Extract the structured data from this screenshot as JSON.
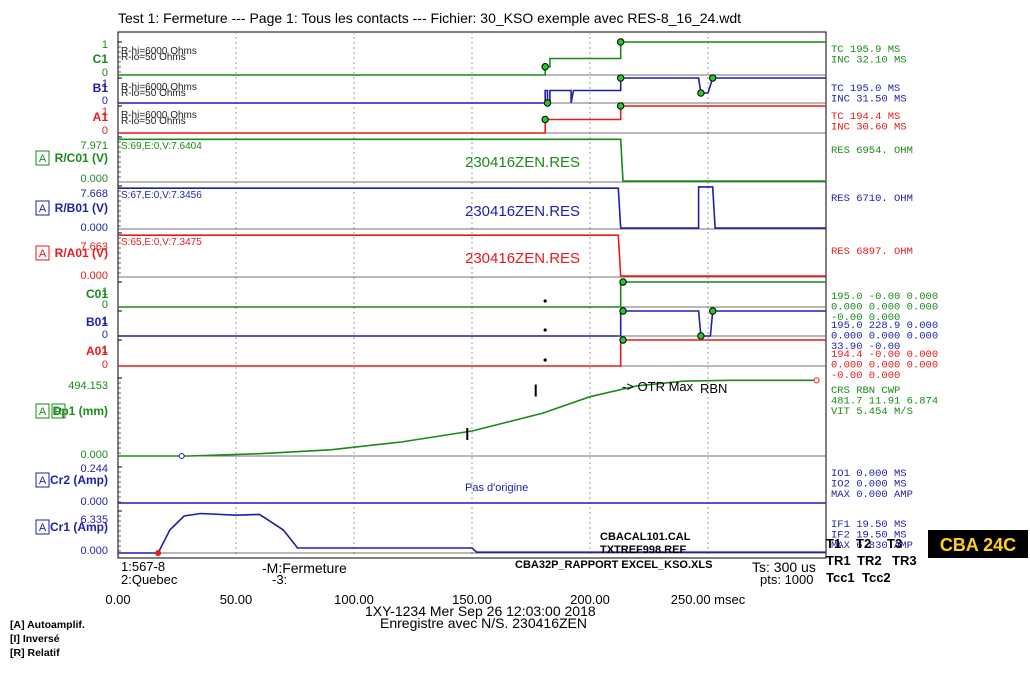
{
  "header": {
    "title": "Test 1: Fermeture --- Page 1: Tous les contacts  --- Fichier: 30_KSO exemple avec  RES-8_16_24.wdt"
  },
  "colors": {
    "green": "#1a8a1a",
    "lightgreen": "#33dd33",
    "blue": "#1f1fa8",
    "red": "#e81a1a",
    "black": "#000000",
    "badge_bg": "#000000",
    "badge_fg": "#ffd21a"
  },
  "chart_data": {
    "type": "line",
    "x_axis": {
      "min": 0,
      "max": 300,
      "unit": "msec",
      "ticks": [
        0,
        50,
        100,
        150,
        200,
        250
      ],
      "tick_labels": [
        "0.00",
        "50.00",
        "100.00",
        "150.00",
        "200.00",
        "250.00 msec"
      ]
    },
    "channels": [
      {
        "key": "c1",
        "label": "C1",
        "color": "green",
        "top": "1",
        "bottom": "0",
        "texts": [
          "R-hi=6000 Ohms",
          "R-lo=50 Ohms"
        ],
        "right_lines": [
          "TC       195.9  MS",
          "INC      32.10  MS"
        ],
        "points": [
          [
            0,
            0
          ],
          [
            181,
            0
          ],
          [
            181,
            0.25
          ],
          [
            183,
            0.25
          ],
          [
            183,
            0.5
          ],
          [
            213,
            0.5
          ],
          [
            213,
            1
          ],
          [
            300,
            1
          ]
        ],
        "markers": [
          181,
          213
        ]
      },
      {
        "key": "b1",
        "label": "B1",
        "color": "blue",
        "top": "1",
        "bottom": "0",
        "texts": [
          "R-hi=6000 Ohms",
          "R-lo=50 Ohms"
        ],
        "right_lines": [
          "TC       195.0  MS",
          "INC      31.50  MS"
        ],
        "points": [
          [
            0,
            0
          ],
          [
            181,
            0
          ],
          [
            181,
            0.5
          ],
          [
            182,
            0.5
          ],
          [
            182,
            0
          ],
          [
            183,
            0
          ],
          [
            183,
            0.5
          ],
          [
            192,
            0.5
          ],
          [
            192,
            0
          ],
          [
            193,
            0.5
          ],
          [
            213,
            0.5
          ],
          [
            213,
            1
          ],
          [
            246,
            1
          ],
          [
            247,
            0.4
          ],
          [
            250,
            0.4
          ],
          [
            252,
            1
          ],
          [
            300,
            1
          ]
        ],
        "markers": [
          182,
          213,
          247,
          252
        ]
      },
      {
        "key": "a1",
        "label": "A1",
        "color": "red",
        "top": "1",
        "bottom": "0",
        "texts": [
          "R-hi=6000 Ohms",
          "R-lo=50 Ohms"
        ],
        "right_lines": [
          "TC       194.4  MS",
          "INC      30.60  MS"
        ],
        "points": [
          [
            0,
            0
          ],
          [
            181,
            0
          ],
          [
            181,
            0.5
          ],
          [
            213,
            0.5
          ],
          [
            213,
            1
          ],
          [
            300,
            1
          ]
        ],
        "markers": [
          181,
          213
        ]
      },
      {
        "key": "rc01",
        "label": "R/C01 (V)",
        "flags": [
          "A"
        ],
        "color": "green",
        "top": "7.971",
        "bottom": "0.000",
        "texts": [
          "S:69,E:0,V:7.6404"
        ],
        "res": "230416ZEN.RES",
        "right_lines": [
          "RES      6954.  OHM"
        ],
        "points": [
          [
            0,
            0.95
          ],
          [
            180,
            0.95
          ],
          [
            213,
            0.95
          ],
          [
            214,
            0.02
          ],
          [
            300,
            0.02
          ]
        ],
        "markers": []
      },
      {
        "key": "rb01",
        "label": "R/B01 (V)",
        "flags": [
          "A"
        ],
        "color": "blue",
        "top": "7.668",
        "bottom": "0.000",
        "texts": [
          "S:67,E:0,V:7.3456"
        ],
        "res": "230416ZEN.RES",
        "right_lines": [
          "RES      6710.  OHM"
        ],
        "points": [
          [
            0,
            0.95
          ],
          [
            212,
            0.95
          ],
          [
            213,
            0.02
          ],
          [
            246,
            0.02
          ],
          [
            246,
            0.98
          ],
          [
            252,
            0.98
          ],
          [
            253,
            0.02
          ],
          [
            300,
            0.02
          ]
        ],
        "markers": []
      },
      {
        "key": "ra01",
        "label": "R/A01 (V)",
        "flags": [
          "A"
        ],
        "color": "red",
        "top": "7.663",
        "bottom": "0.000",
        "texts": [
          "S:65,E:0,V:7.3475"
        ],
        "res": "230416ZEN.RES",
        "right_lines": [
          "RES      6897.  OHM"
        ],
        "points": [
          [
            0,
            0.95
          ],
          [
            212,
            0.95
          ],
          [
            213,
            0.02
          ],
          [
            300,
            0.02
          ]
        ],
        "markers": []
      },
      {
        "key": "c01",
        "label": "C01",
        "color": "green",
        "top": "1",
        "bottom": "0",
        "texts": [],
        "right_lines": [
          "195.0 -0.00 0.000",
          "0.000 0.000 0.000",
          "-0.00 0.000"
        ],
        "points": [
          [
            0,
            0
          ],
          [
            213,
            0
          ],
          [
            213,
            1
          ],
          [
            300,
            1
          ]
        ],
        "markers": [
          214
        ]
      },
      {
        "key": "b01",
        "label": "B01",
        "color": "blue",
        "top": "1",
        "bottom": "0",
        "texts": [],
        "right_lines": [
          "195.0 228.9 0.000",
          "0.000 0.000 0.000",
          "33.90 -0.00"
        ],
        "points": [
          [
            0,
            0
          ],
          [
            213,
            0
          ],
          [
            213,
            1
          ],
          [
            246,
            1
          ],
          [
            247,
            0
          ],
          [
            251,
            0
          ],
          [
            252,
            1
          ],
          [
            300,
            1
          ]
        ],
        "markers": [
          214,
          247,
          252
        ]
      },
      {
        "key": "a01",
        "label": "A01",
        "color": "red",
        "top": "1",
        "bottom": "0",
        "texts": [],
        "right_lines": [
          "194.4 -0.00 0.000",
          "0.000 0.000 0.000",
          "-0.00 0.000"
        ],
        "points": [
          [
            0,
            0
          ],
          [
            213,
            0
          ],
          [
            213,
            1
          ],
          [
            300,
            1
          ]
        ],
        "markers": [
          214
        ]
      },
      {
        "key": "dp1",
        "label": "Dp1 (mm)",
        "flags": [
          "A",
          "R"
        ],
        "color": "green",
        "top": "494.153",
        "bottom": "0.000",
        "texts": [],
        "right_lines": [
          "CRS      RBN    CWP",
          "481.7  11.91  6.874",
          "VIT    5.454  M/S"
        ],
        "annotations": [
          "->   OTR Max",
          "RBN"
        ],
        "points": [
          [
            0,
            0
          ],
          [
            30,
            0
          ],
          [
            60,
            0.03
          ],
          [
            90,
            0.08
          ],
          [
            120,
            0.18
          ],
          [
            150,
            0.32
          ],
          [
            180,
            0.55
          ],
          [
            200,
            0.76
          ],
          [
            220,
            0.9
          ],
          [
            240,
            0.96
          ],
          [
            260,
            0.97
          ],
          [
            280,
            0.97
          ],
          [
            296,
            0.97
          ]
        ],
        "markers": []
      },
      {
        "key": "cr2",
        "label": "Cr2 (Amp)",
        "flags": [
          "A"
        ],
        "color": "blue",
        "top": "0.244",
        "bottom": "0.000",
        "texts": [],
        "note": "Pas d'origine",
        "right_lines": [
          "IO1      0.000  MS",
          "IO2      0.000  MS",
          "MAX      0.000  AMP"
        ],
        "points": [
          [
            0,
            0
          ],
          [
            300,
            0
          ]
        ],
        "markers": []
      },
      {
        "key": "cr1",
        "label": "Cr1 (Amp)",
        "flags": [
          "A"
        ],
        "color": "blue",
        "top": "6.335",
        "bottom": "0.000",
        "texts": [],
        "right_lines": [
          "IF1      19.50  MS",
          "IF2      19.50  MS",
          "MAX      6.830  AMP"
        ],
        "points": [
          [
            0,
            0
          ],
          [
            17,
            0
          ],
          [
            22,
            0.55
          ],
          [
            28,
            0.88
          ],
          [
            35,
            0.94
          ],
          [
            50,
            0.9
          ],
          [
            60,
            0.92
          ],
          [
            70,
            0.55
          ],
          [
            75,
            0.2
          ],
          [
            76,
            0.12
          ],
          [
            150,
            0.12
          ],
          [
            152,
            0.02
          ],
          [
            300,
            0.02
          ]
        ],
        "markers": []
      }
    ],
    "info_block": [
      "CBACAL101.CAL",
      "TXTREF998.REF",
      "CBA32P_RAPPORT EXCEL_KSO.XLS"
    ],
    "footer_left": [
      "1:567-8",
      "2:Quebec"
    ],
    "footer_mid": [
      "-M:Fermeture",
      "-3:"
    ],
    "footer_center": [
      "1XY-1234   Mer Sep 26 12:03:00 2018",
      "Enregistre avec N/S. 230416ZEN"
    ],
    "footer_ts": [
      "Ts: 300 us",
      "pts: 1000"
    ],
    "triggers": [
      "T1",
      "T2",
      "T3",
      "TR1",
      "TR2",
      "TR3",
      "Tcc1",
      "Tcc2"
    ],
    "badge": "CBA 24C",
    "legend": [
      "[A] Autoamplif.",
      "[I] Inversé",
      "[R] Relatif"
    ]
  }
}
